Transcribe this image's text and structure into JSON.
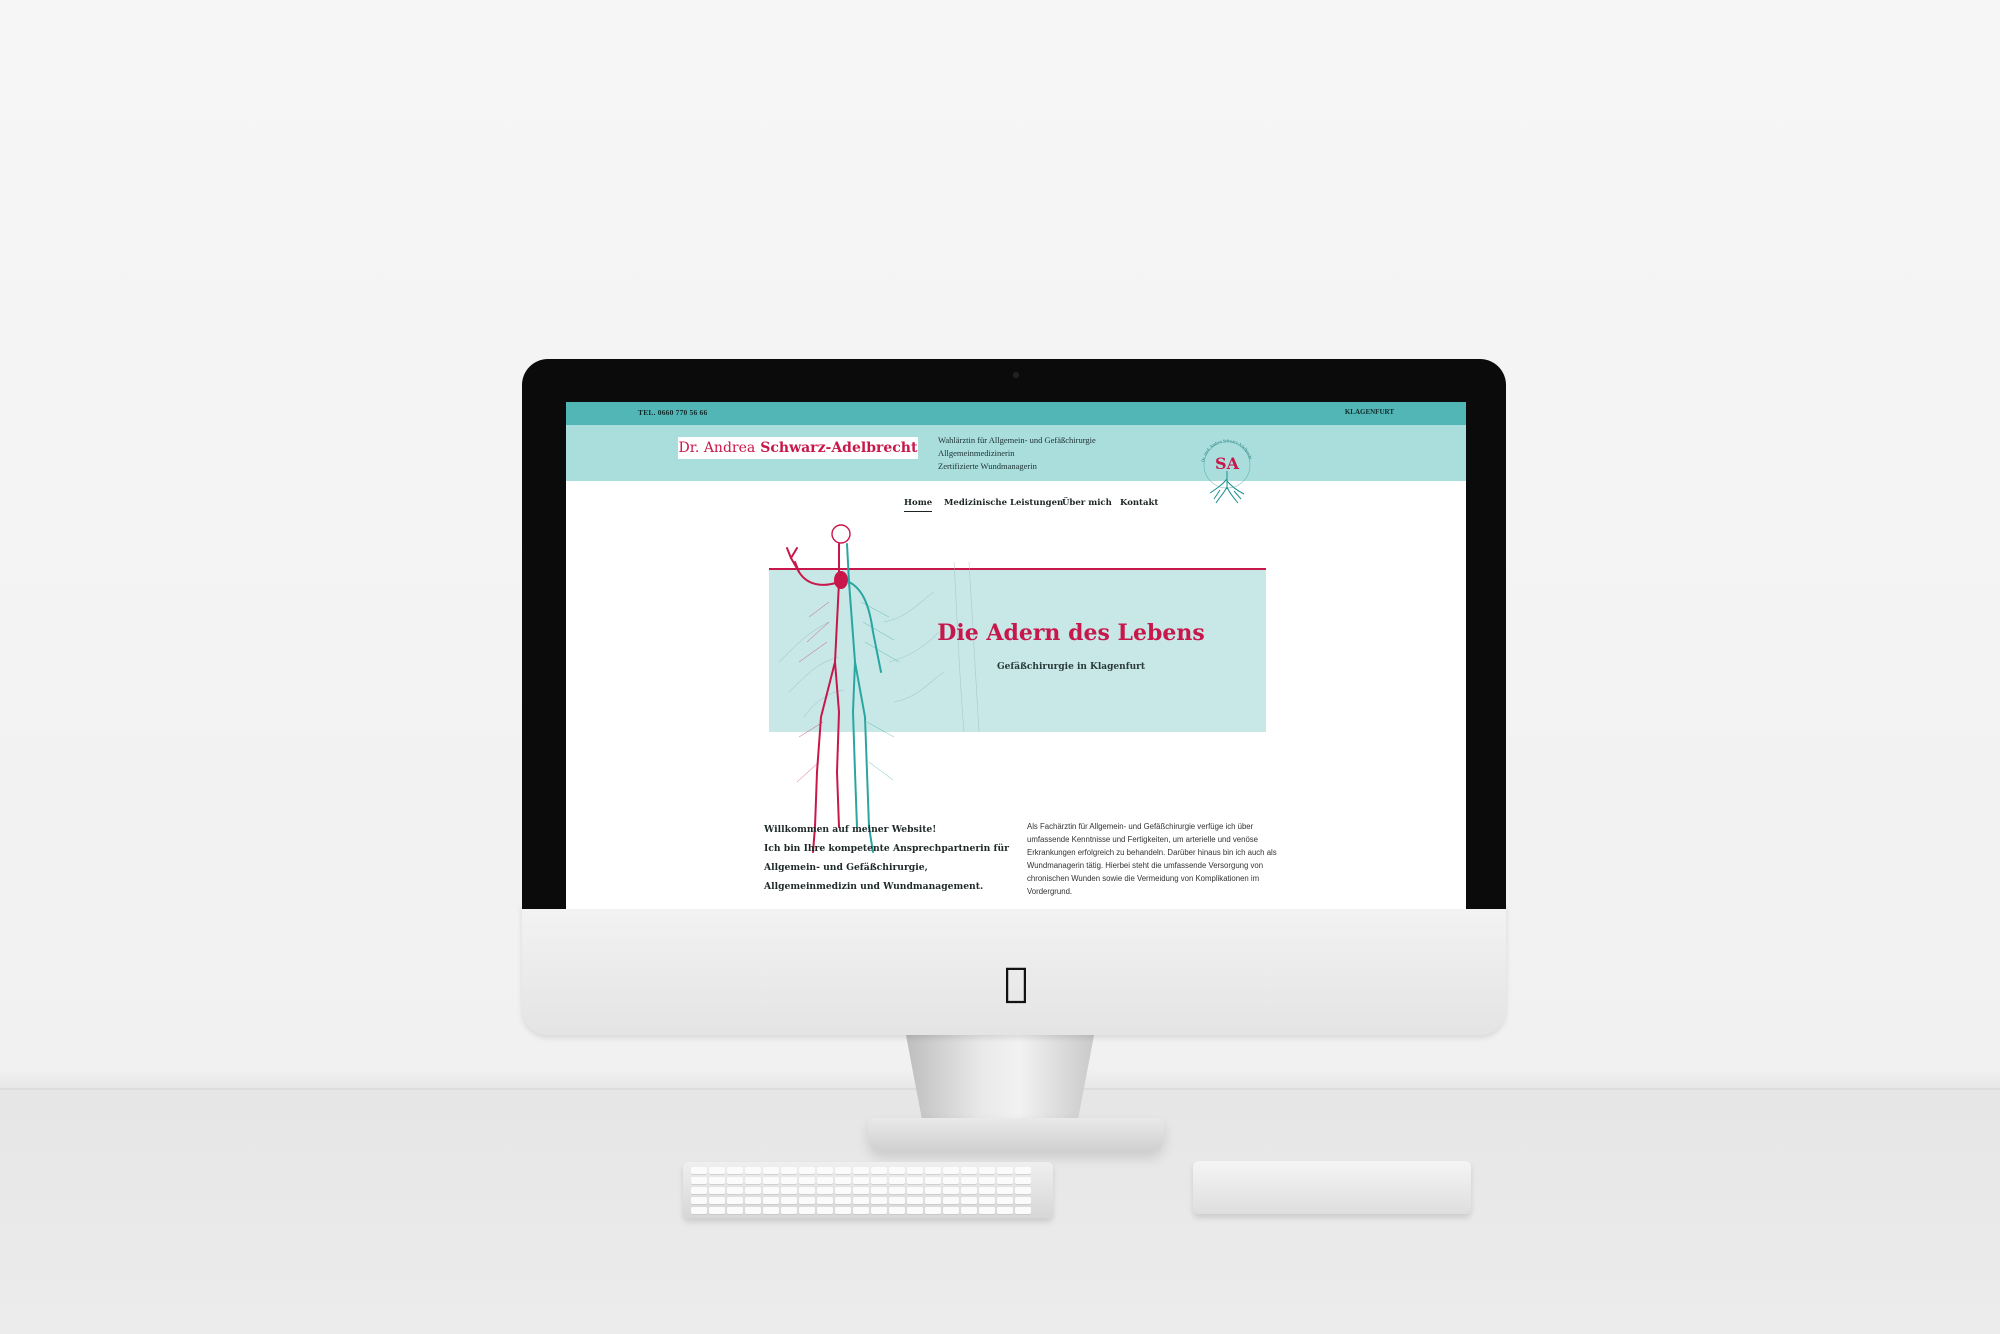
{
  "site": {
    "topbar": {
      "phone": "TEL. 0660 770 56 66",
      "city": "KLAGENFURT"
    },
    "header": {
      "name_first": "Dr. Andrea",
      "name_last": "Schwarz-Adelbrecht",
      "qualifications": [
        "Wahlärztin für Allgemein- und Gefäßchirurgie",
        "Allgemeinmedizinerin",
        "Zertifizierte Wundmanagerin"
      ],
      "emblem_monogram": "SA",
      "emblem_ring_text": "Dr. med. Andrea Schwarz-Adelbrecht"
    },
    "nav": {
      "home": "Home",
      "services": "Medizinische Leistungen",
      "about": "Über mich",
      "contact": "Kontakt"
    },
    "hero": {
      "title": "Die Adern des Lebens",
      "subtitle": "Gefäßchirurgie in Klagenfurt"
    },
    "welcome": {
      "line1": "Willkommen auf meiner Website!",
      "line2": "Ich bin Ihre kompetente Ansprechpartnerin für",
      "line3": "Allgemein- und Gefäßchirurgie,",
      "line4": "Allgemeinmedizin und Wundmanagement."
    },
    "intro": "Als Fachärztin für Allgemein- und Gefäßchirurgie verfüge ich über umfassende Kenntnisse und Fertigkeiten, um arterielle und venöse Erkrankungen erfolgreich zu behandeln. Darüber hinaus bin ich auch als Wundmanagerin tätig. Hierbei steht die umfassende Versorgung von chronischen Wunden sowie die Vermeidung von Komplikationen im Vordergrund.",
    "colors": {
      "teal": "#53b6b6",
      "light_teal": "#a9dedd",
      "crimson": "#c8174a"
    }
  },
  "device": {
    "apple_logo": "apple-icon"
  }
}
